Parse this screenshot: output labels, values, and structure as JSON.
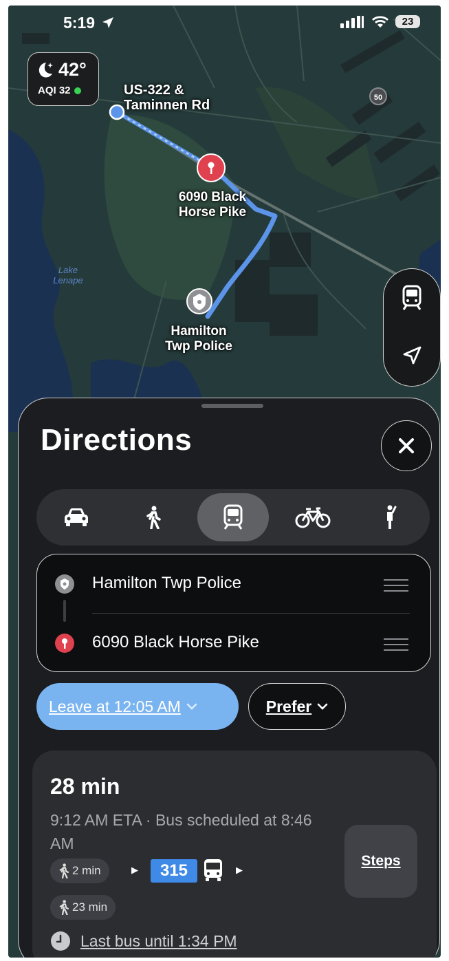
{
  "status_bar": {
    "time": "5:19",
    "battery": "23"
  },
  "weather": {
    "temperature": "42°",
    "aqi": "AQI 32"
  },
  "map": {
    "labels": {
      "origin_stop": "US-322 &\nTaminnen Rd",
      "destination": "6090 Black\nHorse Pike",
      "police": "Hamilton\nTwp Police",
      "lake": "Lake\nLenape",
      "route_shield": "50"
    }
  },
  "sheet": {
    "title": "Directions",
    "modes": [
      "drive",
      "walk",
      "transit",
      "cycle",
      "rideshare"
    ],
    "selected_mode": "transit",
    "route": {
      "from": "Hamilton Twp Police",
      "to": "6090 Black Horse Pike"
    },
    "leave_label": "Leave at 12:05 AM",
    "prefer_label": "Prefer",
    "result": {
      "duration": "28 min",
      "eta": "9:12 AM ETA · Bus scheduled at 8:46 AM",
      "walk1": "2 min",
      "bus_number": "315",
      "walk2": "23 min",
      "steps_label": "Steps",
      "last_bus": "Last bus until 1:34 PM"
    }
  },
  "colors": {
    "route_line": "#5b94e8",
    "leave_pill": "#79b4f0",
    "bus_badge": "#3f8ae6",
    "destination_pin": "#e0414f",
    "aqi_good": "#39d353"
  }
}
